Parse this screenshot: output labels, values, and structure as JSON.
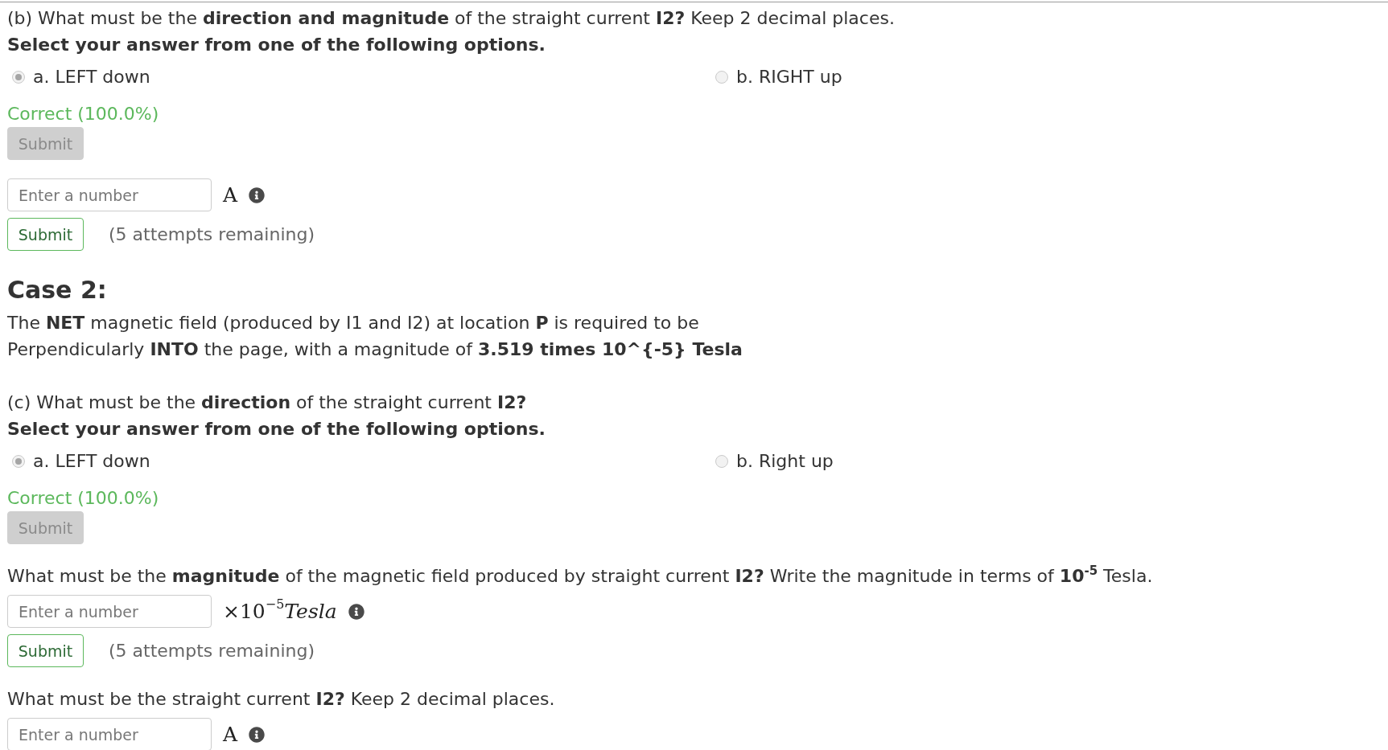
{
  "items": [
    {
      "kind": "question",
      "lines": [
        "(b) What must be the **direction and magnitude** of the straight current **I2?** Keep 2 decimal places.",
        "**Select your answer from one of the following options.**"
      ]
    },
    {
      "kind": "choices",
      "disabled": true,
      "options": [
        {
          "label": "a. LEFT down",
          "selected": true
        },
        {
          "label": "b. RIGHT up",
          "selected": false
        }
      ]
    },
    {
      "kind": "feedback",
      "text": "Correct (100.0%)"
    },
    {
      "kind": "submit",
      "label": "Submit",
      "disabled": true
    },
    {
      "kind": "answer",
      "placeholder": "Enter a number",
      "unit": "A"
    },
    {
      "kind": "submit",
      "label": "Submit",
      "disabled": false,
      "attempts": "(5 attempts remaining)"
    },
    {
      "kind": "heading",
      "text": "Case 2:"
    },
    {
      "kind": "paragraph",
      "lines": [
        "The **NET** magnetic field (produced by I1 and I2) at location **P** is required to be",
        "Perpendicularly **INTO** the page, with a magnitude of **3.519 times 10^{-5} Tesla**"
      ]
    },
    {
      "kind": "question",
      "lines": [
        "(c) What must be the **direction** of the straight current **I2?**",
        "**Select your answer from one of the following options.**"
      ]
    },
    {
      "kind": "choices",
      "disabled": true,
      "options": [
        {
          "label": "a. LEFT down",
          "selected": true
        },
        {
          "label": "b. Right up",
          "selected": false
        }
      ]
    },
    {
      "kind": "feedback",
      "text": "Correct (100.0%)"
    },
    {
      "kind": "submit",
      "label": "Submit",
      "disabled": true
    },
    {
      "kind": "question",
      "lines": [
        "What must be the **magnitude** of the magnetic field produced by straight current **I2?** Write the magnitude in terms of **10**$^{-5}$ Tesla."
      ]
    },
    {
      "kind": "answer",
      "placeholder": "Enter a number",
      "unit": "×10$^{−5}$*Tesla*"
    },
    {
      "kind": "submit",
      "label": "Submit",
      "disabled": false,
      "attempts": "(5 attempts remaining)"
    },
    {
      "kind": "question",
      "lines": [
        "What must be the straight current **I2?** Keep 2 decimal places."
      ]
    },
    {
      "kind": "answer",
      "placeholder": "Enter a number",
      "unit": "A"
    }
  ]
}
